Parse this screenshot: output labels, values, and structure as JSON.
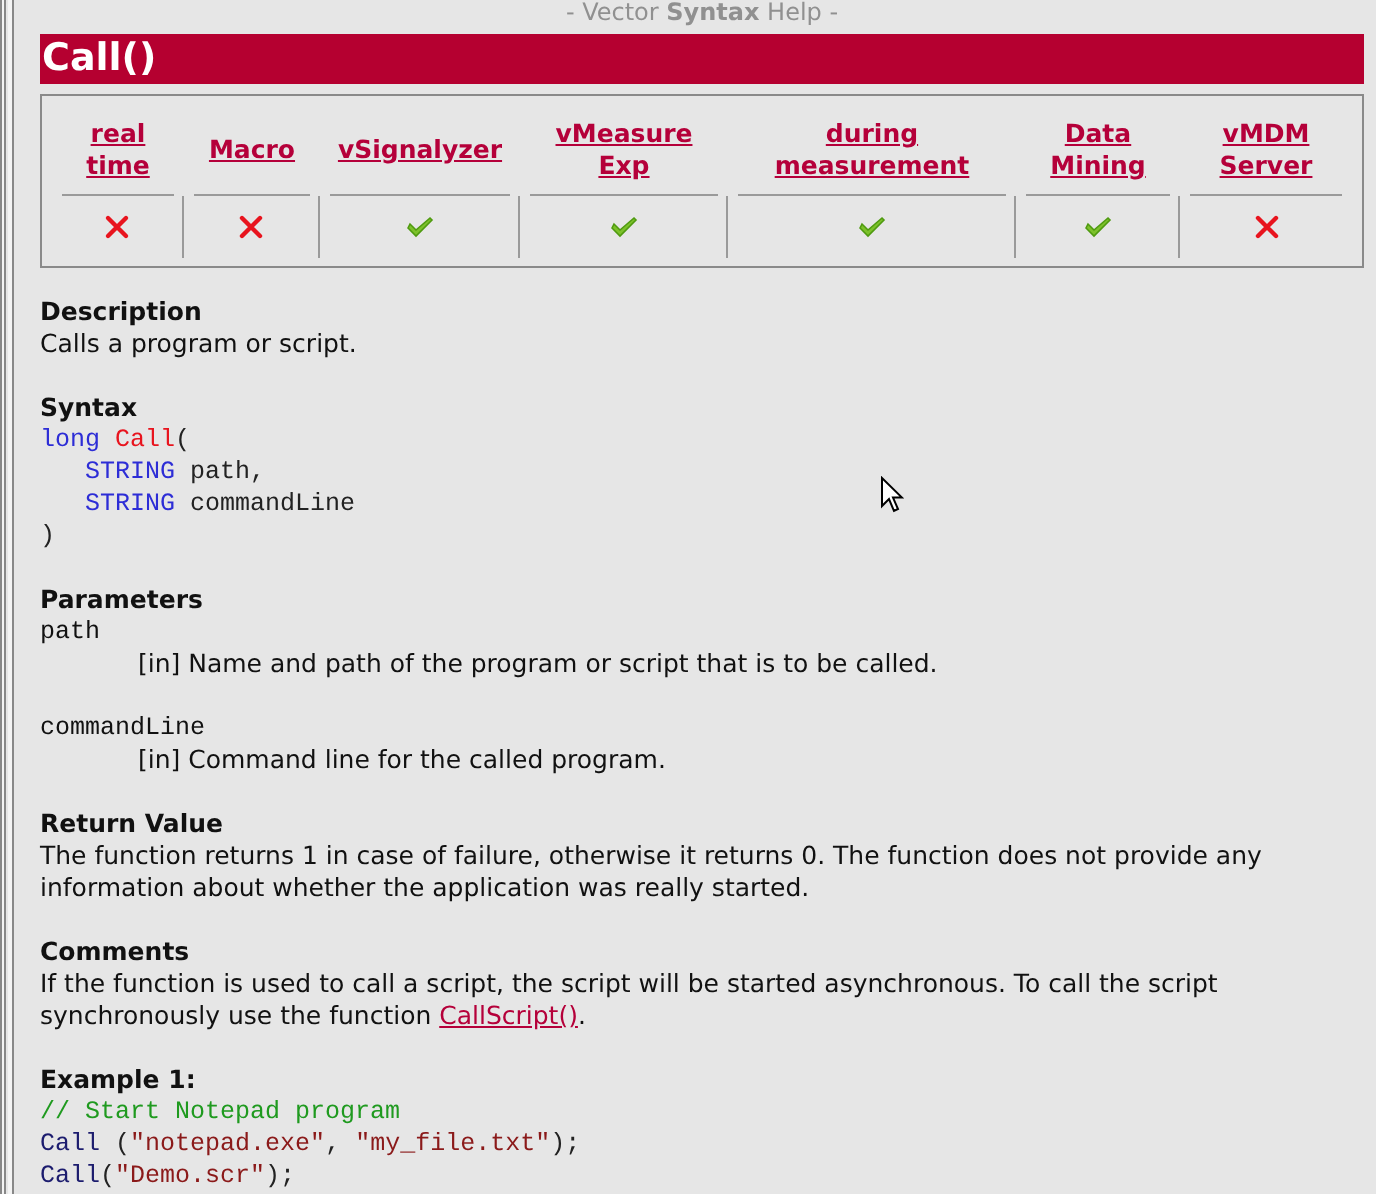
{
  "header": "- Vector **Syntax** Help -",
  "title": "Call()",
  "availability": [
    {
      "label": "real time",
      "available": false
    },
    {
      "label": "Macro",
      "available": false
    },
    {
      "label": "vSignalyzer",
      "available": true
    },
    {
      "label": "vMeasure Exp",
      "available": true
    },
    {
      "label": "during measurement",
      "available": true
    },
    {
      "label": "Data Mining",
      "available": true
    },
    {
      "label": "vMDM Server",
      "available": false
    }
  ],
  "sections": [
    {
      "kind": "text",
      "heading": "Description",
      "text": "Calls a program or script."
    },
    {
      "kind": "code",
      "heading": "Syntax",
      "lines": [
        [
          {
            "kind": "keyword",
            "text": "long"
          },
          {
            "kind": "name",
            "text": "Call"
          },
          {
            "kind": "plain",
            "text": "("
          }
        ],
        [
          {
            "kind": "indent"
          },
          {
            "kind": "keyword",
            "text": "STRING"
          },
          {
            "kind": "plain",
            "text": "path,"
          }
        ],
        [
          {
            "kind": "indent"
          },
          {
            "kind": "keyword",
            "text": "STRING"
          },
          {
            "kind": "plain",
            "text": "commandLine"
          }
        ],
        [
          {
            "kind": "plain",
            "text": ")"
          }
        ]
      ]
    },
    {
      "kind": "params",
      "heading": "Parameters",
      "params": [
        {
          "name": "path",
          "text": "[in] Name and path of the program or script that is to be called."
        },
        {
          "name": "commandLine",
          "text": "[in] Command line for the called program."
        }
      ]
    },
    {
      "kind": "text",
      "heading": "Return Value",
      "text": "The function returns 1 in case of failure, otherwise it returns 0. The function does not provide any information about whether the application was really started."
    },
    {
      "kind": "link_text",
      "heading": "Comments",
      "before": "If the function is used to call a script, the script will be started asynchronous. To call the script synchronously use the function ",
      "link": "CallScript()",
      "after": "."
    },
    {
      "kind": "code",
      "heading": "Example 1:",
      "lines": [
        [
          {
            "kind": "comment",
            "text": "// Start Notepad program"
          }
        ],
        [
          {
            "kind": "call",
            "text": "Call"
          },
          {
            "kind": "plain",
            "text": "("
          },
          {
            "kind": "string",
            "text": "\"notepad.exe\""
          },
          {
            "kind": "plain",
            "text": ", "
          },
          {
            "kind": "string",
            "text": "\"my_file.txt\""
          },
          {
            "kind": "plain",
            "text": ");"
          }
        ],
        [
          {
            "kind": "callnospace",
            "text": "Call"
          },
          {
            "kind": "plain",
            "text": "("
          },
          {
            "kind": "string",
            "text": "\"Demo.scr\""
          },
          {
            "kind": "plain",
            "text": ");"
          }
        ]
      ]
    }
  ]
}
